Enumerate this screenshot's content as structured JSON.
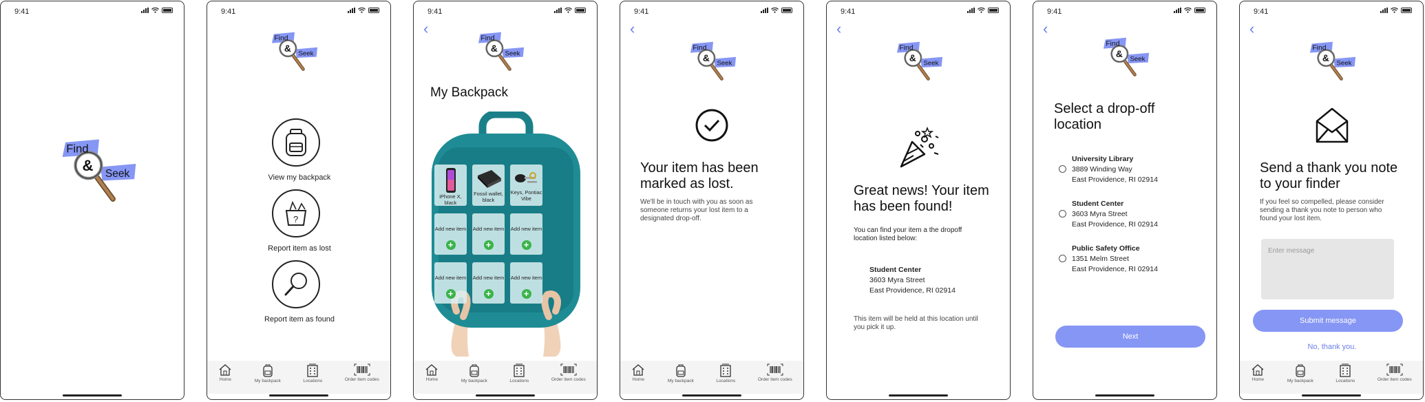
{
  "status": {
    "time": "9:41"
  },
  "logo": {
    "word1": "Find",
    "amp": "&",
    "word2": "Seek"
  },
  "tabs": [
    {
      "label": "Home",
      "icon": "home-icon"
    },
    {
      "label": "My backpack",
      "icon": "backpack-icon"
    },
    {
      "label": "Locations",
      "icon": "building-icon"
    },
    {
      "label": "Order item codes",
      "icon": "barcode-icon"
    }
  ],
  "home": {
    "view_backpack": "View my backpack",
    "report_lost": "Report item as lost",
    "report_found": "Report item as found"
  },
  "backpack": {
    "title": "My Backpack",
    "items": [
      {
        "label": "iPhone X, black",
        "kind": "phone"
      },
      {
        "label": "Fossil wallet, black",
        "kind": "wallet"
      },
      {
        "label": "Keys, Pontiac Vibe",
        "kind": "keys"
      },
      {
        "label": "Add new item",
        "kind": "add"
      },
      {
        "label": "Add new item",
        "kind": "add"
      },
      {
        "label": "Add new item",
        "kind": "add"
      },
      {
        "label": "Add new item",
        "kind": "add"
      },
      {
        "label": "Add new item",
        "kind": "add"
      },
      {
        "label": "Add new item",
        "kind": "add"
      }
    ]
  },
  "lost": {
    "title": "Your item has been marked as lost.",
    "body": "We'll be in touch with you as soon as someone returns your lost item to a designated drop-off."
  },
  "found": {
    "title": "Great news! Your item has been found!",
    "intro": "You can find your item a the dropoff location listed below:",
    "loc_name": "Student Center",
    "loc_street": "3603 Myra Street",
    "loc_city": "East Providence, RI 02914",
    "note": "This item will be held at this location until you pick it up."
  },
  "dropoff": {
    "title": "Select a drop-off location",
    "locations": [
      {
        "name": "University Library",
        "street": "3889 Winding Way",
        "city": "East Providence, RI 02914"
      },
      {
        "name": "Student Center",
        "street": "3603 Myra Street",
        "city": "East Providence, RI 02914"
      },
      {
        "name": "Public Safety Office",
        "street": "1351 Melm Street",
        "city": "East Providence, RI 02914"
      }
    ],
    "next": "Next"
  },
  "thanks": {
    "title": "Send a thank you note to your finder",
    "body": "If you feel so compelled, please consider sending a thank you note to person who found your lost item.",
    "placeholder": "Enter message",
    "submit": "Submit message",
    "decline": "No, thank you."
  },
  "colors": {
    "accent": "#8696f4",
    "teal": "#1f8c95",
    "green": "#3bb34a"
  }
}
